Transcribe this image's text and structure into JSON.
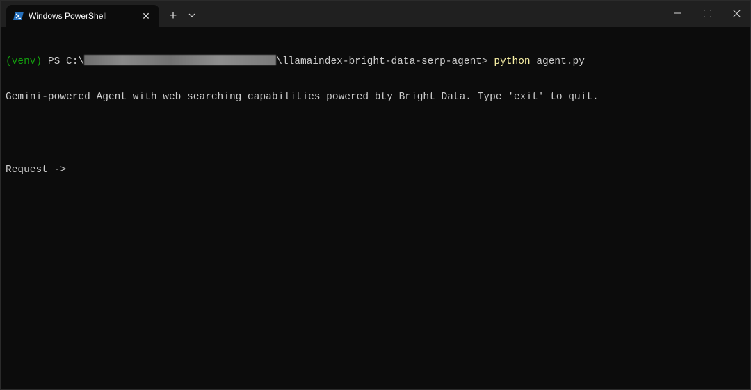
{
  "tab": {
    "title": "Windows PowerShell",
    "icon": "powershell-icon"
  },
  "titlebar": {
    "new_tab_symbol": "+",
    "close_tab_symbol": "✕"
  },
  "terminal": {
    "line1": {
      "venv": "(venv)",
      "prompt_prefix": " PS C:\\",
      "path_suffix": "\\llamaindex-bright-data-serp-agent>",
      "command": " python",
      "args": " agent.py"
    },
    "line2": "Gemini-powered Agent with web searching capabilities powered bty Bright Data. Type 'exit' to quit.",
    "line3": "",
    "line4": "Request ->"
  },
  "colors": {
    "background": "#0c0c0c",
    "titlebar": "#202020",
    "text": "#cccccc",
    "venv": "#13a10e",
    "command": "#f9f1a5"
  }
}
